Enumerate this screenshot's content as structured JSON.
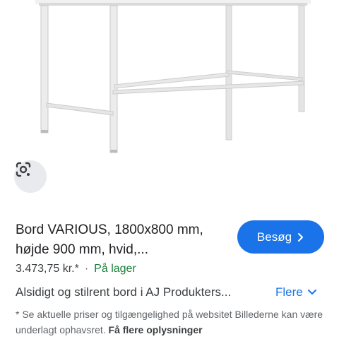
{
  "product": {
    "title": "Bord VARIOUS, 1800x800 mm, højde 900 mm, hvid,...",
    "price": "3.473,75 kr.*",
    "separator": "·",
    "stock": "På lager",
    "description": "Alsidigt og stilrent bord i AJ Produkters...",
    "more_label": "Flere",
    "visit_label": "Besøg",
    "disclaimer": "* Se aktuelle priser og tilgængelighed på websitet Billederne kan være underlagt ophavsret.",
    "disclaimer_link": "Få flere oplysninger"
  },
  "icons": {
    "lens": "google-lens-icon",
    "visit_chevron": "chevron-right-icon",
    "more_chevron": "chevron-down-icon"
  },
  "colors": {
    "accent": "#1a73e8",
    "stock": "#188038",
    "lens_bg": "#e8eaed"
  }
}
